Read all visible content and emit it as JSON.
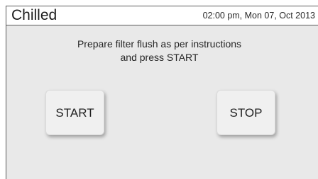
{
  "header": {
    "title": "Chilled",
    "datetime": "02:00 pm, Mon 07, Oct 2013"
  },
  "message": {
    "line1": "Prepare filter flush as per instructions",
    "line2": "and press START"
  },
  "buttons": {
    "start_label": "START",
    "stop_label": "STOP"
  },
  "colors": {
    "background": "#e9e9e9",
    "title_bar": "#ffffff",
    "border": "#5a5a5a",
    "button": "#f0f0f0",
    "text": "#222222"
  }
}
